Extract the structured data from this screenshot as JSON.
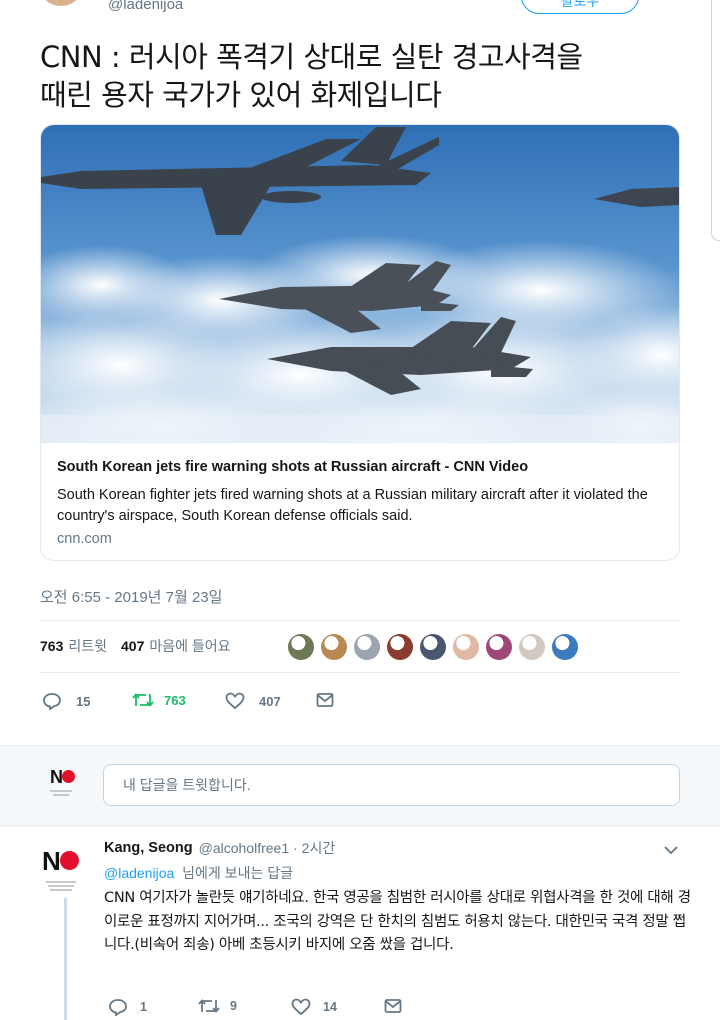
{
  "top": {
    "handle": "@ladenijoa",
    "follow_label": "팔로우"
  },
  "tweet": {
    "text_line1": "CNN : 러시아 폭격기 상대로 실탄 경고사격을",
    "text_line2": "때린 용자 국가가 있어 화제입니다"
  },
  "card": {
    "title": "South Korean jets fire warning shots at Russian aircraft - CNN Video",
    "description": "South Korean fighter jets fired warning shots at a Russian military aircraft after it violated the country's airspace, South Korean defense officials said.",
    "domain": "cnn.com"
  },
  "timestamp": "오전 6:55 - 2019년 7월 23일",
  "stats": {
    "retweets_count": "763",
    "retweets_label": "리트윗",
    "likes_count": "407",
    "likes_label": "마음에 들어요"
  },
  "likers": [
    {
      "icon": "avatar-plant",
      "color": "#6b7a55"
    },
    {
      "icon": "avatar-cat",
      "color": "#b68a52"
    },
    {
      "icon": "avatar-default",
      "color": "#9aa5af"
    },
    {
      "icon": "avatar-car",
      "color": "#8b3b2f"
    },
    {
      "icon": "avatar-photo",
      "color": "#4a5670"
    },
    {
      "icon": "avatar-anime",
      "color": "#e0b8a4"
    },
    {
      "icon": "avatar-flower",
      "color": "#a0477a"
    },
    {
      "icon": "avatar-cat-white",
      "color": "#cfc9c0"
    },
    {
      "icon": "avatar-landscape",
      "color": "#3b7bbf"
    }
  ],
  "actions": {
    "reply_count": "15",
    "retweet_count": "763",
    "like_count": "407"
  },
  "reply_box": {
    "placeholder": "내 답글을 트윗합니다."
  },
  "reply": {
    "name": "Kang, Seong",
    "handle": "@alcoholfree1",
    "time": "· 2시간",
    "to_handle": "@ladenijoa",
    "to_suffix": "님에게 보내는 답글",
    "body": "CNN 여기자가 놀란듯 얘기하네요. 한국 영공을 침범한 러시아를 상대로 위협사격을 한 것에 대해 경이로운 표정까지 지어가며... 조국의 강역은 단 한치의 침범도 허용치 않는다. 대한민국 국격 정말 쩝니다.(비속어 죄송) 아베 초등시키 바지에 오줌 쌌을 겁니다.",
    "reply_count": "1",
    "retweet_count": "9",
    "like_count": "14"
  },
  "colors": {
    "accent": "#1da1f2",
    "retweet_green": "#17bf63",
    "no_red": "#e0102a",
    "muted": "#657786"
  }
}
